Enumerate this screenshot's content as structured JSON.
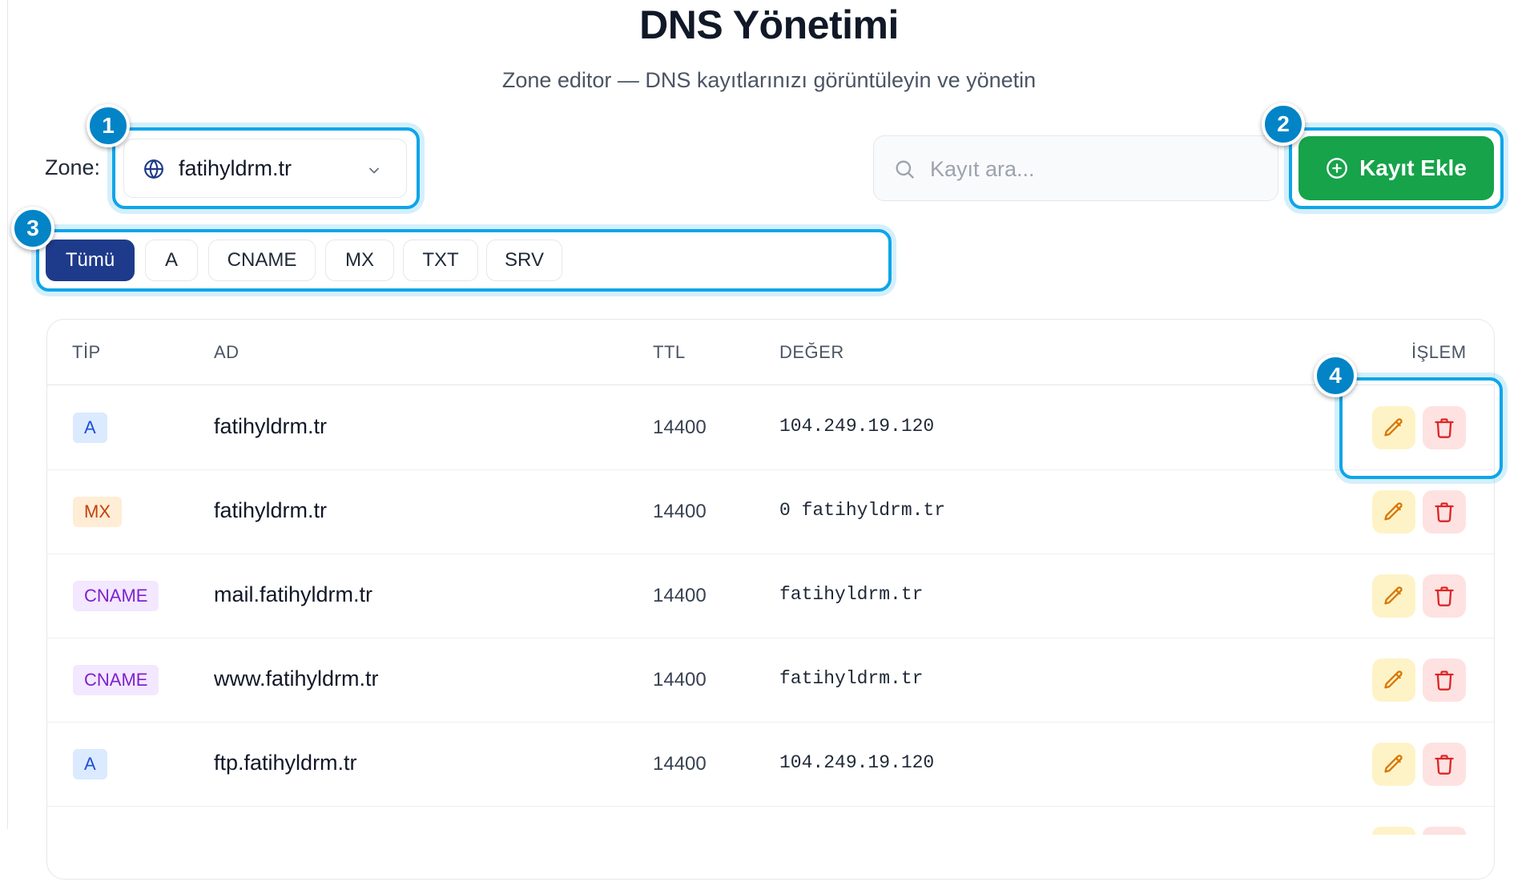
{
  "header": {
    "title": "DNS Yönetimi",
    "subtitle": "Zone editor — DNS kayıtlarınızı görüntüleyin ve yönetin"
  },
  "zone": {
    "label": "Zone:",
    "selected": "fatihyldrm.tr",
    "icon": "globe-icon"
  },
  "search": {
    "placeholder": "Kayıt ara...",
    "value": "",
    "icon": "search-icon"
  },
  "add_button": {
    "label": "Kayıt Ekle",
    "icon": "plus-circle-icon"
  },
  "filters": [
    {
      "label": "Tümü",
      "active": true
    },
    {
      "label": "A",
      "active": false
    },
    {
      "label": "CNAME",
      "active": false
    },
    {
      "label": "MX",
      "active": false
    },
    {
      "label": "TXT",
      "active": false
    },
    {
      "label": "SRV",
      "active": false
    }
  ],
  "table": {
    "columns": [
      "TİP",
      "AD",
      "TTL",
      "DEĞER",
      "İŞLEM"
    ],
    "rows": [
      {
        "type": "A",
        "name": "fatihyldrm.tr",
        "ttl": "14400",
        "value": "104.249.19.120"
      },
      {
        "type": "MX",
        "name": "fatihyldrm.tr",
        "ttl": "14400",
        "value": "0 fatihyldrm.tr"
      },
      {
        "type": "CNAME",
        "name": "mail.fatihyldrm.tr",
        "ttl": "14400",
        "value": "fatihyldrm.tr"
      },
      {
        "type": "CNAME",
        "name": "www.fatihyldrm.tr",
        "ttl": "14400",
        "value": "fatihyldrm.tr"
      },
      {
        "type": "A",
        "name": "ftp.fatihyldrm.tr",
        "ttl": "14400",
        "value": "104.249.19.120"
      }
    ],
    "action_icons": [
      "pencil-icon",
      "trash-icon"
    ]
  },
  "callouts": [
    "1",
    "2",
    "3",
    "4"
  ],
  "colors": {
    "primary": "#1e3a8a",
    "success": "#16a34a",
    "callout": "#0ea5e9",
    "badge_A": "#dbeafe",
    "badge_MX": "#ffedd5",
    "badge_CNAME": "#f3e8ff"
  }
}
